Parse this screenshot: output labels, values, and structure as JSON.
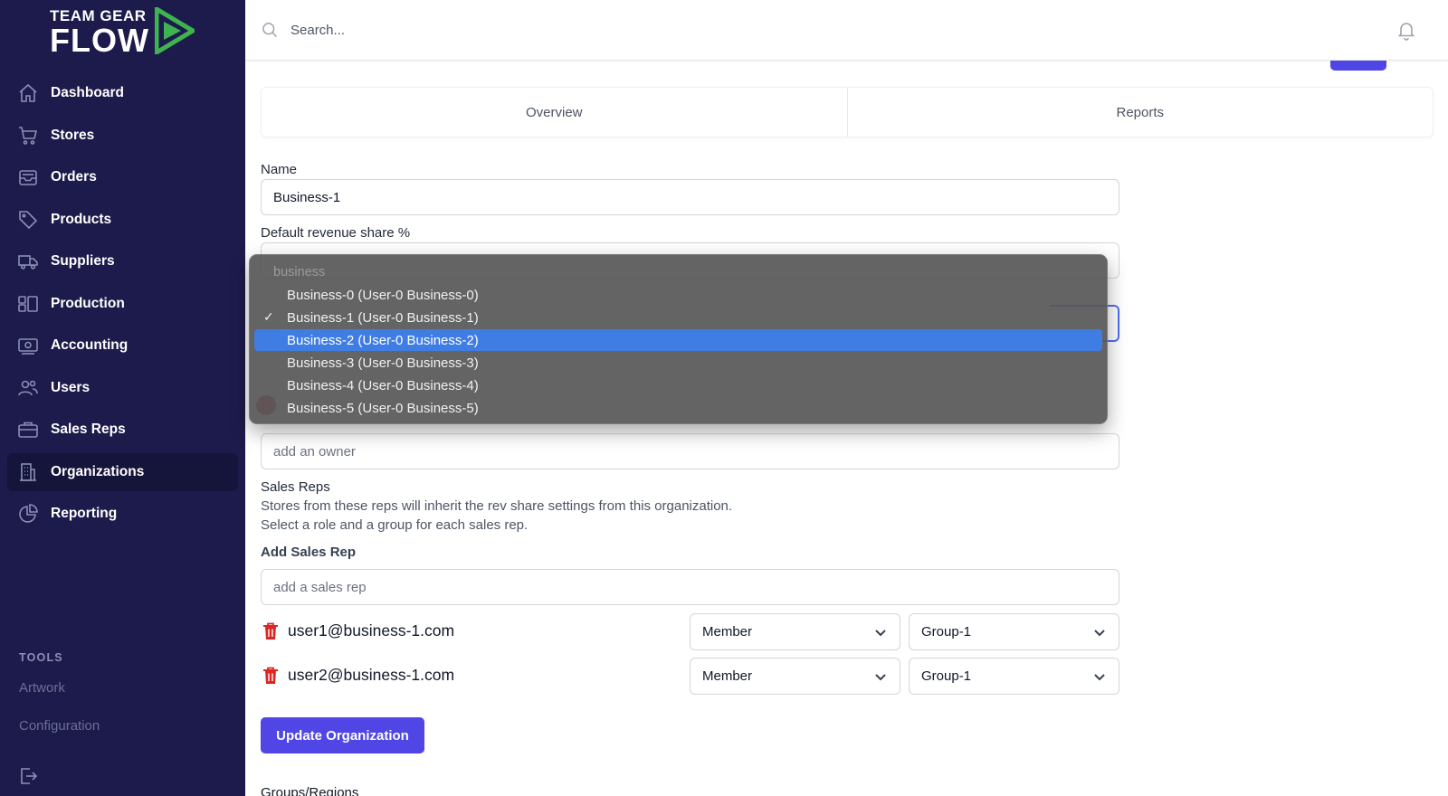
{
  "brand": {
    "line1": "TEAM GEAR",
    "line2": "FLOW",
    "accent": "#3fb34f"
  },
  "sidebar": {
    "items": [
      {
        "label": "Dashboard",
        "icon": "home-icon"
      },
      {
        "label": "Stores",
        "icon": "cart-icon"
      },
      {
        "label": "Orders",
        "icon": "inbox-icon"
      },
      {
        "label": "Products",
        "icon": "tag-icon"
      },
      {
        "label": "Suppliers",
        "icon": "truck-icon"
      },
      {
        "label": "Production",
        "icon": "layout-icon"
      },
      {
        "label": "Accounting",
        "icon": "cash-icon"
      },
      {
        "label": "Users",
        "icon": "users-icon"
      },
      {
        "label": "Sales Reps",
        "icon": "briefcase-icon"
      },
      {
        "label": "Organizations",
        "icon": "building-icon",
        "active": true
      },
      {
        "label": "Reporting",
        "icon": "chart-pie-icon"
      }
    ],
    "tools_title": "TOOLS",
    "tools": [
      "Artwork",
      "Configuration"
    ]
  },
  "topbar": {
    "search_placeholder": "Search..."
  },
  "tabs": [
    "Overview",
    "Reports"
  ],
  "form": {
    "name_label": "Name",
    "name_value": "Business-1",
    "revenue_label": "Default revenue share %",
    "owner_placeholder": "add an owner",
    "sales_reps_label": "Sales Reps",
    "sales_reps_help1": "Stores from these reps will inherit the rev share settings from this organization.",
    "sales_reps_help2": "Select a role and a group for each sales rep.",
    "add_rep_label": "Add Sales Rep",
    "add_rep_placeholder": "add a sales rep",
    "reps": [
      {
        "email": "user1@business-1.com",
        "role": "Member",
        "group": "Group-1"
      },
      {
        "email": "user2@business-1.com",
        "role": "Member",
        "group": "Group-1"
      }
    ],
    "update_button": "Update Organization",
    "next_section": "Groups/Regions"
  },
  "dropdown": {
    "header": "business",
    "options": [
      "Business-0 (User-0 Business-0)",
      "Business-1 (User-0 Business-1)",
      "Business-2 (User-0 Business-2)",
      "Business-3 (User-0 Business-3)",
      "Business-4 (User-0 Business-4)",
      "Business-5 (User-0 Business-5)"
    ],
    "checked_index": 1,
    "highlighted_index": 2,
    "check_mark": "✓"
  },
  "colors": {
    "sidebar_bg": "#1c1b4b",
    "primary": "#4f46e5",
    "danger": "#dc2626",
    "highlight": "#3f7de3"
  }
}
